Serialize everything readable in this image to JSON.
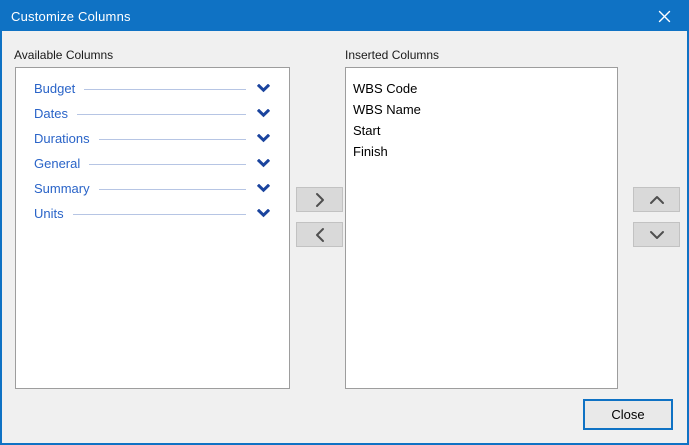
{
  "window": {
    "title": "Customize Columns"
  },
  "available": {
    "label": "Available Columns",
    "groups": [
      {
        "label": "Budget"
      },
      {
        "label": "Dates"
      },
      {
        "label": "Durations"
      },
      {
        "label": "General"
      },
      {
        "label": "Summary"
      },
      {
        "label": "Units"
      }
    ]
  },
  "inserted": {
    "label": "Inserted Columns",
    "items": [
      "WBS Code",
      "WBS Name",
      "Start",
      "Finish"
    ]
  },
  "buttons": {
    "close_label": "Close"
  },
  "icons": {
    "titlebar_close": "close-icon",
    "group_expand": "chevron-down-icon",
    "move_right": "chevron-right-icon",
    "move_left": "chevron-left-icon",
    "move_up": "chevron-up-icon",
    "move_down": "chevron-down-icon"
  },
  "colors": {
    "titlebar_bg": "#0f72c4",
    "titlebar_text": "#ffffff",
    "dialog_border": "#0f72c4",
    "dialog_bg": "#f0f0f0",
    "listbox_bg": "#ffffff",
    "listbox_border": "#9d9d9d",
    "group_text": "#2a64c8",
    "group_chevron": "#1b449e",
    "group_line": "#b6c5e4",
    "item_text": "#000000",
    "button_face": "#d9d9d9",
    "button_border": "#c2c2c2",
    "button_glyph": "#4f4f4f",
    "close_button_border": "#0f72c4"
  }
}
